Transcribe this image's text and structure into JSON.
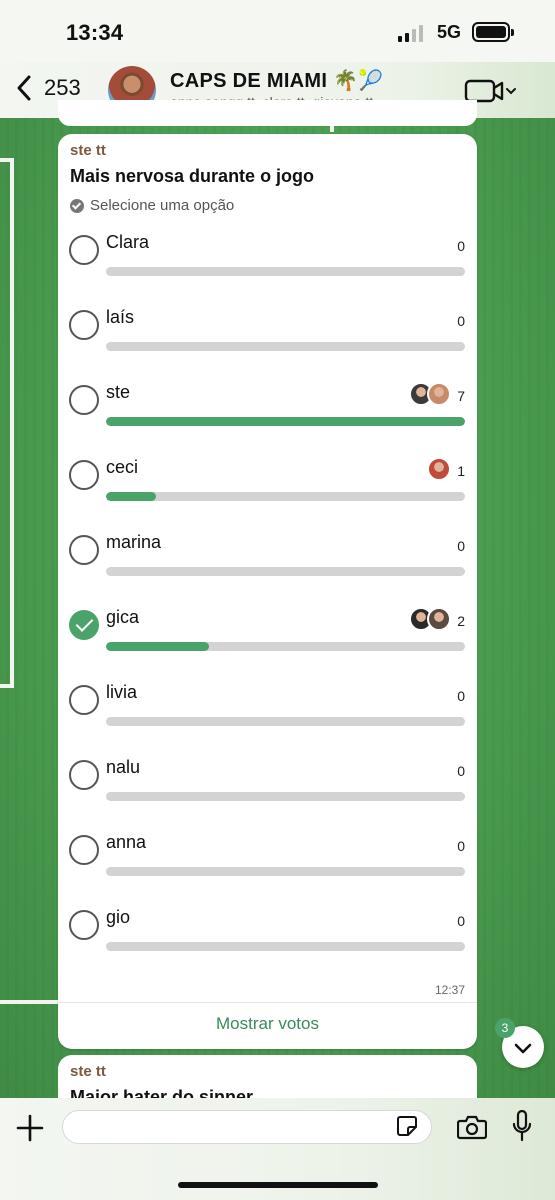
{
  "status_bar": {
    "time": "13:34",
    "network": "5G"
  },
  "header": {
    "back_count": "253",
    "group_name": "CAPS DE MIAMI 🌴🎾",
    "members": "anna songg tt, clara tt, giovana tt,..."
  },
  "poll": {
    "sender": "ste tt",
    "question": "Mais nervosa durante o jogo",
    "hint": "Selecione uma opção",
    "options": [
      {
        "label": "Clara",
        "votes": "0",
        "fill": 0,
        "selected": false,
        "voters": []
      },
      {
        "label": "laís",
        "votes": "0",
        "fill": 0,
        "selected": false,
        "voters": []
      },
      {
        "label": "ste",
        "votes": "7",
        "fill": 1.0,
        "selected": false,
        "voters": [
          "#3b3b3b",
          "#c98a6a"
        ]
      },
      {
        "label": "ceci",
        "votes": "1",
        "fill": 0.14,
        "selected": false,
        "voters": [
          "#c24a3a"
        ]
      },
      {
        "label": "marina",
        "votes": "0",
        "fill": 0,
        "selected": false,
        "voters": []
      },
      {
        "label": "gica",
        "votes": "2",
        "fill": 0.286,
        "selected": true,
        "voters": [
          "#2a2a2a",
          "#5a4a40"
        ]
      },
      {
        "label": "livia",
        "votes": "0",
        "fill": 0,
        "selected": false,
        "voters": []
      },
      {
        "label": "nalu",
        "votes": "0",
        "fill": 0,
        "selected": false,
        "voters": []
      },
      {
        "label": "anna",
        "votes": "0",
        "fill": 0,
        "selected": false,
        "voters": []
      },
      {
        "label": "gio",
        "votes": "0",
        "fill": 0,
        "selected": false,
        "voters": []
      }
    ],
    "time": "12:37",
    "show_votes": "Mostrar votos"
  },
  "next_message": {
    "sender": "ste tt",
    "question": "Maior hater do sinner"
  },
  "scroll_badge": "3",
  "colors": {
    "accent": "#4aa46a",
    "sender": "#7b5a3f",
    "bar_bg": "#d3d3d3"
  },
  "icons": {
    "back": "chevron-left-icon",
    "video": "video-call-icon",
    "plus": "plus-icon",
    "sticker": "sticker-icon",
    "camera": "camera-icon",
    "mic": "microphone-icon",
    "scroll": "chevron-down-icon"
  }
}
